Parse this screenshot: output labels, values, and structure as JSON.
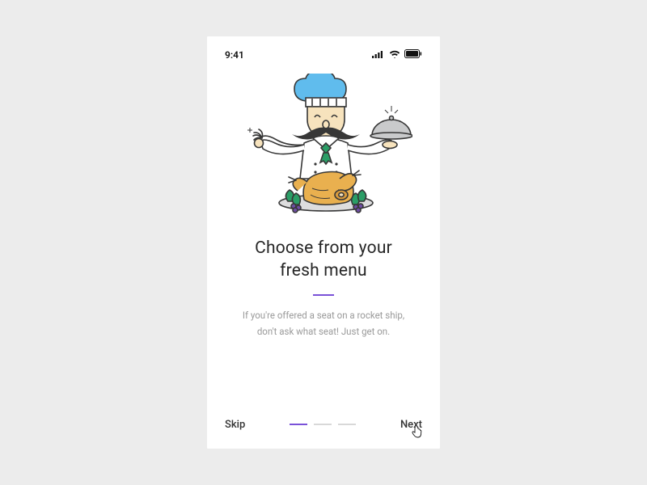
{
  "statusbar": {
    "time": "9:41",
    "signal_icon": "signal-icon",
    "wifi_icon": "wifi-icon",
    "battery_icon": "battery-icon"
  },
  "illustration": {
    "name": "chef-with-turkey-and-cloche",
    "chef_hat_color": "#60bced",
    "jacket_color": "#ffffff",
    "skin_color": "#f7e3bd",
    "neckerchief_color": "#2b9d66",
    "turkey_color": "#e9b04f",
    "garnish_color": "#2b9d66",
    "grape_color": "#6e4da3",
    "cloche_color": "#c9cacb",
    "plate_color": "#ddddde",
    "outline_color": "#373737"
  },
  "title_line1": "Choose from your",
  "title_line2": "fresh menu",
  "accent_color": "#7a52d8",
  "body_line1": "If you're offered a seat on a rocket ship,",
  "body_line2": "don't ask what seat! Just get on.",
  "footer": {
    "skip_label": "Skip",
    "next_label": "Next"
  },
  "pagination": {
    "total": 3,
    "active_index": 0
  }
}
